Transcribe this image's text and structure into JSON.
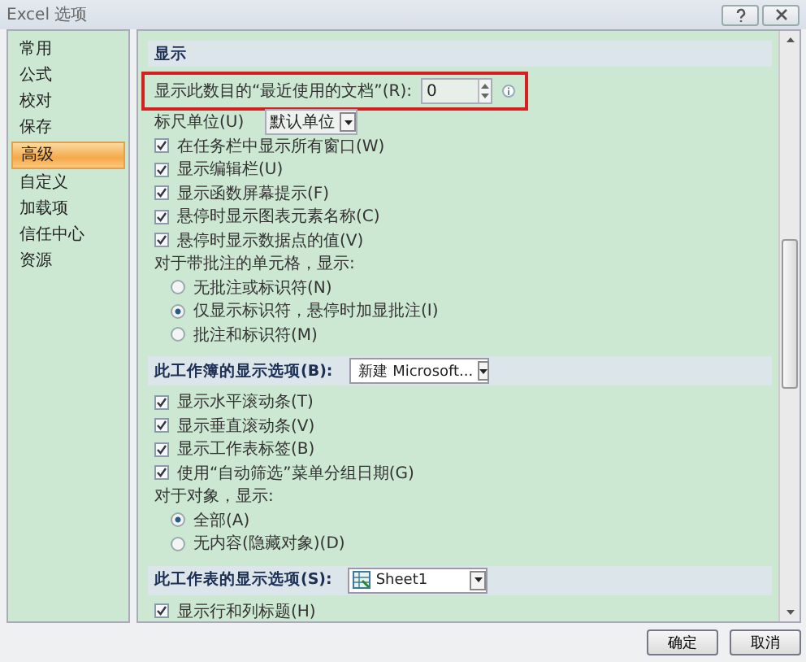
{
  "window": {
    "title": "Excel 选项"
  },
  "sidebar": {
    "items": [
      {
        "label": "常用",
        "selected": false
      },
      {
        "label": "公式",
        "selected": false
      },
      {
        "label": "校对",
        "selected": false
      },
      {
        "label": "保存",
        "selected": false
      },
      {
        "label": "高级",
        "selected": true
      },
      {
        "label": "自定义",
        "selected": false
      },
      {
        "label": "加载项",
        "selected": false
      },
      {
        "label": "信任中心",
        "selected": false
      },
      {
        "label": "资源",
        "selected": false
      }
    ]
  },
  "sections": [
    {
      "title": "显示",
      "rows": [
        {
          "kind": "spin",
          "label": "显示此数目的“最近使用的文档”(R):",
          "value": "0",
          "highlighted": true
        },
        {
          "kind": "dropdown",
          "label": "标尺单位(U)",
          "value": "默认单位"
        },
        {
          "kind": "checkbox",
          "label": "在任务栏中显示所有窗口(W)",
          "checked": true
        },
        {
          "kind": "checkbox",
          "label": "显示编辑栏(U)",
          "checked": true
        },
        {
          "kind": "checkbox",
          "label": "显示函数屏幕提示(F)",
          "checked": true
        },
        {
          "kind": "checkbox",
          "label": "悬停时显示图表元素名称(C)",
          "checked": true
        },
        {
          "kind": "checkbox",
          "label": "悬停时显示数据点的值(V)",
          "checked": true
        },
        {
          "kind": "text",
          "label": "对于带批注的单元格，显示:"
        },
        {
          "kind": "radio",
          "label": "无批注或标识符(N)",
          "selected": false
        },
        {
          "kind": "radio",
          "label": "仅显示标识符，悬停时加显批注(I)",
          "selected": true
        },
        {
          "kind": "radio",
          "label": "批注和标识符(M)",
          "selected": false
        }
      ]
    },
    {
      "title": "此工作簿的显示选项(B):",
      "selector": {
        "kind": "workbook",
        "value": "新建 Microsoft..."
      },
      "rows": [
        {
          "kind": "checkbox",
          "label": "显示水平滚动条(T)",
          "checked": true
        },
        {
          "kind": "checkbox",
          "label": "显示垂直滚动条(V)",
          "checked": true
        },
        {
          "kind": "checkbox",
          "label": "显示工作表标签(B)",
          "checked": true
        },
        {
          "kind": "checkbox",
          "label": "使用“自动筛选”菜单分组日期(G)",
          "checked": true
        },
        {
          "kind": "text",
          "label": "对于对象，显示:"
        },
        {
          "kind": "radio",
          "label": "全部(A)",
          "selected": true
        },
        {
          "kind": "radio",
          "label": "无内容(隐藏对象)(D)",
          "selected": false
        }
      ]
    },
    {
      "title": "此工作表的显示选项(S):",
      "selector": {
        "kind": "sheet",
        "value": "Sheet1"
      },
      "rows": [
        {
          "kind": "checkbox",
          "label": "显示行和列标题(H)",
          "checked": true
        }
      ]
    }
  ],
  "buttons": [
    "确定",
    "取消"
  ]
}
